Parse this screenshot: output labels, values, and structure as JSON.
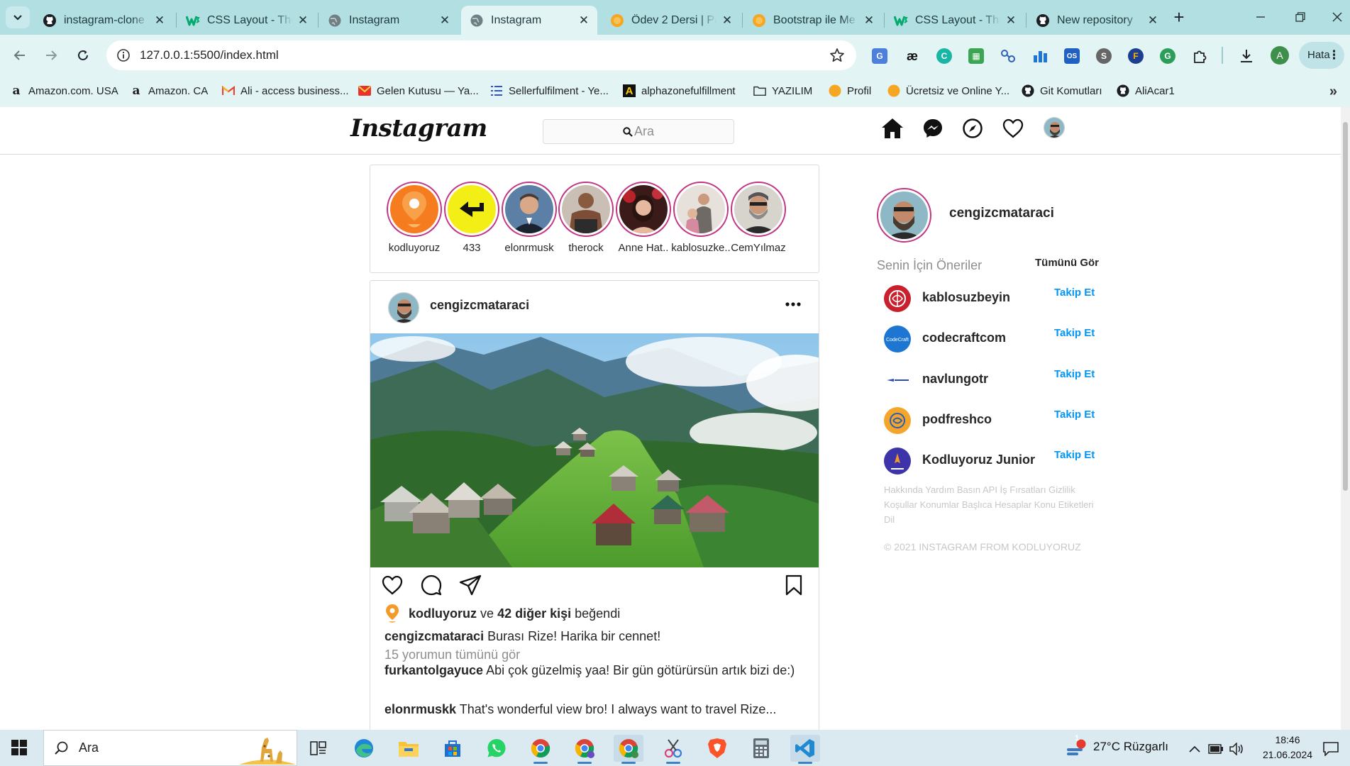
{
  "browser": {
    "tabs": [
      {
        "title": "instagram-clone",
        "favicon": "github-icon"
      },
      {
        "title": "CSS Layout - The",
        "favicon": "w3schools-icon"
      },
      {
        "title": "Instagram",
        "favicon": "globe-icon"
      },
      {
        "title": "Instagram",
        "favicon": "globe-icon",
        "active": true
      },
      {
        "title": "Ödev 2 Dersi | Pa",
        "favicon": "orange-circle-icon"
      },
      {
        "title": "Bootstrap ile Me",
        "favicon": "orange-circle-icon"
      },
      {
        "title": "CSS Layout - The",
        "favicon": "w3schools-icon"
      },
      {
        "title": "New repository",
        "favicon": "github-icon"
      }
    ],
    "close_glyph": "✕",
    "new_tab": "+",
    "url": "127.0.0.1:5500/index.html",
    "profile_letter": "A",
    "error_pill": "Hata",
    "bookmarks": [
      {
        "label": "Amazon.com. USA",
        "icon": "amazon-icon"
      },
      {
        "label": "Amazon. CA",
        "icon": "amazon-icon"
      },
      {
        "label": "Ali - access business...",
        "icon": "gmail-icon"
      },
      {
        "label": "Gelen Kutusu — Ya...",
        "icon": "mail-icon"
      },
      {
        "label": "Sellerfulfilment - Ye...",
        "icon": "list-icon"
      },
      {
        "label": "alphazonefulfillment",
        "icon": "a-logo-icon"
      },
      {
        "label": "YAZILIM",
        "icon": "folder-icon"
      },
      {
        "label": "Profil",
        "icon": "orange-circle-icon"
      },
      {
        "label": "Ücretsiz ve Online Y...",
        "icon": "orange-circle-icon"
      },
      {
        "label": "Git Komutları",
        "icon": "github-icon"
      },
      {
        "label": "AliAcar1",
        "icon": "github-icon"
      }
    ]
  },
  "instagram": {
    "logo": "Instagram",
    "search_placeholder": "Ara",
    "stories": [
      {
        "name": "kodluyoruz"
      },
      {
        "name": "433"
      },
      {
        "name": "elonrmusk"
      },
      {
        "name": "therock"
      },
      {
        "name": "Anne Hat.."
      },
      {
        "name": "kablosuzke.."
      },
      {
        "name": "CemYılmaz"
      }
    ],
    "post": {
      "username": "cengizcmataraci",
      "liked_by": "kodluyoruz",
      "liked_and": "ve",
      "liked_count": "42 diğer kişi",
      "liked_suffix": "beğendi",
      "caption_user": "cengizcmataraci",
      "caption_text": "Burası Rize! Harika bir cennet!",
      "view_comments": "15 yorumun tümünü gör",
      "comments": [
        {
          "user": "furkantolgayuce",
          "text": "Abi çok güzelmiş yaa! Bir gün götürürsün artık bizi de:)"
        },
        {
          "user": "elonrmuskk",
          "text": "That's wonderful view bro! I always want to travel Rize..."
        }
      ]
    },
    "sidebar": {
      "username": "cengizcmataraci",
      "suggestions_title": "Senin İçin Öneriler",
      "see_all": "Tümünü Gör",
      "suggestions": [
        {
          "name": "kablosuzbeyin",
          "action": "Takip Et"
        },
        {
          "name": "codecraftcom",
          "action": "Takip Et",
          "badge": "CodeCraft"
        },
        {
          "name": "navlungotr",
          "action": "Takip Et"
        },
        {
          "name": "podfreshco",
          "action": "Takip Et"
        },
        {
          "name": "Kodluyoruz Junior",
          "action": "Takip Et"
        }
      ],
      "footer_links": "Hakkında Yardım Basın API İş Fırsatları Gizlilik Koşullar Konumlar Başlıca Hesaplar Konu Etiketleri Dil",
      "copyright": "© 2021 INSTAGRAM FROM KODLUYORUZ"
    }
  },
  "taskbar": {
    "search_placeholder": "Ara",
    "weather": "27°C  Rüzgarlı",
    "time": "18:46",
    "date": "21.06.2024",
    "notification_count": "1"
  },
  "colors": {
    "chrome_tabstrip": "#b2dfe2",
    "chrome_toolbar": "#e3f4f5",
    "story_ring": "#c13584",
    "follow_blue": "#0095f6",
    "taskbar": "#dbe9f1"
  }
}
